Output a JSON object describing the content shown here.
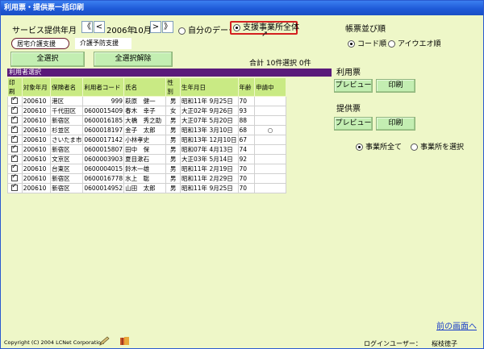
{
  "window": {
    "title": "利用票・提供票一括印刷"
  },
  "service_period": {
    "label": "サービス提供年月",
    "first_btn": "《",
    "prev_btn": "<",
    "year": "2006年",
    "month": "10月",
    "next_btn": ">",
    "last_btn": "》"
  },
  "data_scope": {
    "own_label": "自分のデータ",
    "all_label": "支援事業所全体",
    "selected": "all"
  },
  "tabs": [
    {
      "label": "居宅介護支援",
      "active": true
    },
    {
      "label": "介護予防支援",
      "active": false
    }
  ],
  "buttons": {
    "select_all": "全選択",
    "deselect_all": "全選択解除"
  },
  "totals": {
    "total": "合計 10件",
    "selected": "選択 0件"
  },
  "user_select_header": "利用者選択",
  "columns": [
    "印刷",
    "対象年月",
    "保険者名",
    "利用者コード",
    "氏名",
    "性別",
    "生年月日",
    "年齢",
    "申請中"
  ],
  "rows": [
    {
      "print": true,
      "ym": "200610",
      "insurer": "港区",
      "code": "999",
      "name": "萩原　健一",
      "sex": "男",
      "birth": "昭和11年 9月25日",
      "age": "70",
      "applying": ""
    },
    {
      "print": true,
      "ym": "200610",
      "insurer": "千代田区",
      "code": "0600015409",
      "name": "春木　幸子",
      "sex": "女",
      "birth": "大正02年 9月26日",
      "age": "93",
      "applying": ""
    },
    {
      "print": true,
      "ym": "200610",
      "insurer": "新宿区",
      "code": "0600016185",
      "name": "大橋　秀之助",
      "sex": "男",
      "birth": "大正07年 5月20日",
      "age": "88",
      "applying": ""
    },
    {
      "print": true,
      "ym": "200610",
      "insurer": "杉並区",
      "code": "0600018197",
      "name": "金子　太郎",
      "sex": "男",
      "birth": "昭和13年 3月10日",
      "age": "68",
      "applying": "○"
    },
    {
      "print": true,
      "ym": "200610",
      "insurer": "さいたま市",
      "code": "0600017142",
      "name": "小林孝史",
      "sex": "男",
      "birth": "昭和13年 12月10日",
      "age": "67",
      "applying": ""
    },
    {
      "print": true,
      "ym": "200610",
      "insurer": "新宿区",
      "code": "0600015807",
      "name": "田中　保",
      "sex": "男",
      "birth": "昭和07年 4月13日",
      "age": "74",
      "applying": ""
    },
    {
      "print": true,
      "ym": "200610",
      "insurer": "文京区",
      "code": "0600003903",
      "name": "夏目漱石",
      "sex": "男",
      "birth": "大正03年 5月14日",
      "age": "92",
      "applying": ""
    },
    {
      "print": true,
      "ym": "200610",
      "insurer": "台東区",
      "code": "0600004015",
      "name": "鈴木一雄",
      "sex": "男",
      "birth": "昭和11年 2月19日",
      "age": "70",
      "applying": ""
    },
    {
      "print": true,
      "ym": "200610",
      "insurer": "新宿区",
      "code": "0600016778",
      "name": "水上　聡",
      "sex": "男",
      "birth": "昭和11年 2月29日",
      "age": "70",
      "applying": ""
    },
    {
      "print": true,
      "ym": "200610",
      "insurer": "新宿区",
      "code": "0600014952",
      "name": "山田　太郎",
      "sex": "男",
      "birth": "昭和11年 9月25日",
      "age": "70",
      "applying": ""
    }
  ],
  "sort_order": {
    "heading": "帳票並び順",
    "code_label": "コード順",
    "kana_label": "アイウエオ順",
    "selected": "code"
  },
  "usage_sheet": {
    "heading": "利用票",
    "preview": "プレビュー",
    "print": "印刷"
  },
  "provision_sheet": {
    "heading": "提供票",
    "preview": "プレビュー",
    "print": "印刷"
  },
  "office_scope": {
    "all_label": "事業所全て",
    "select_label": "事業所を選択",
    "selected": "all"
  },
  "footer": {
    "copyright": "Copyright (C) 2004 LCNet Corporation",
    "back_link": "前の画面へ",
    "login_label": "ログインユーザー：",
    "login_user": "桜枝徳子"
  },
  "colors": {
    "background": "#eef7c8",
    "titlebar": "#1f5ad8",
    "table_header": "#c9ea84",
    "section_bar": "#5a1a7a",
    "highlight_border": "#d42020",
    "button_green": "#c3eeb2"
  }
}
